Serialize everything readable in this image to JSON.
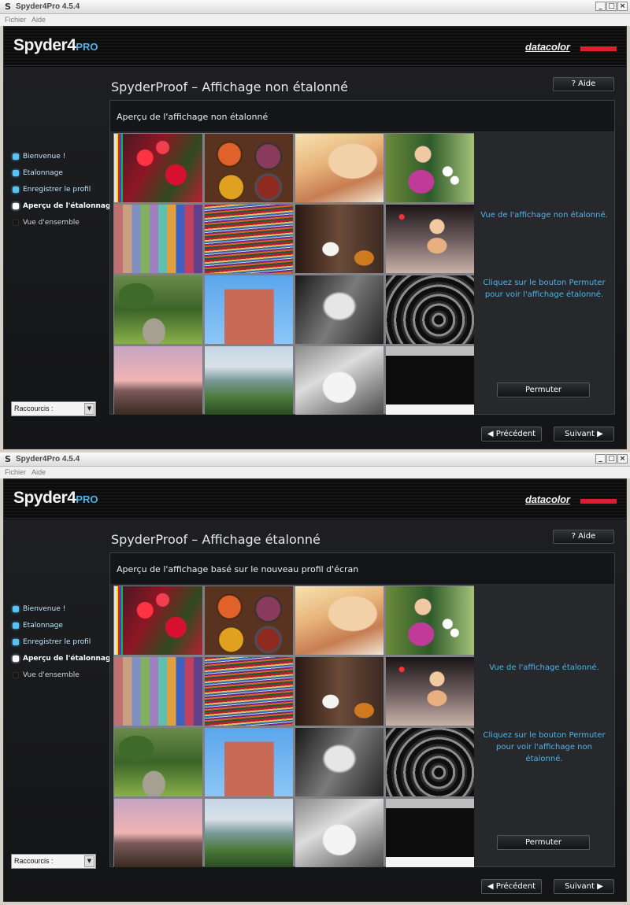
{
  "windows": [
    {
      "title": "Spyder4Pro 4.5.4",
      "menu": [
        "Fichier",
        "Aide"
      ],
      "logo": {
        "main": "Spyder4",
        "suffix": "PRO"
      },
      "brand": "datacolor",
      "heading": "SpyderProof – Affichage non étalonné",
      "help_label": "? Aide",
      "panel_title": "Aperçu de l'affichage non étalonné",
      "steps": [
        {
          "label": "Bienvenue !",
          "state": "done"
        },
        {
          "label": "Etalonnage",
          "state": "done"
        },
        {
          "label": "Enregistrer le profil",
          "state": "done"
        },
        {
          "label": "Aperçu de l'étalonnage",
          "state": "active"
        },
        {
          "label": "Vue d'ensemble",
          "state": "inactive"
        }
      ],
      "shortcut_label": "Raccourcis :",
      "message_view": "Vue de l'affichage non étalonné.",
      "message_hint": "Cliquez sur le bouton Permuter pour voir l'affichage étalonné.",
      "permuter_label": "Permuter",
      "prev_label": "◀ Précédent",
      "next_label": "Suivant ▶"
    },
    {
      "title": "Spyder4Pro 4.5.4",
      "menu": [
        "Fichier",
        "Aide"
      ],
      "logo": {
        "main": "Spyder4",
        "suffix": "PRO"
      },
      "brand": "datacolor",
      "heading": "SpyderProof – Affichage étalonné",
      "help_label": "? Aide",
      "panel_title": "Aperçu de l'affichage basé sur le nouveau profil d'écran",
      "steps": [
        {
          "label": "Bienvenue !",
          "state": "done"
        },
        {
          "label": "Etalonnage",
          "state": "done"
        },
        {
          "label": "Enregistrer le profil",
          "state": "done"
        },
        {
          "label": "Aperçu de l'étalonnage",
          "state": "active"
        },
        {
          "label": "Vue d'ensemble",
          "state": "inactive"
        }
      ],
      "shortcut_label": "Raccourcis :",
      "message_view": "Vue de l'affichage étalonné.",
      "message_hint": "Cliquez sur le bouton Permuter pour voir l'affichage non étalonné.",
      "permuter_label": "Permuter",
      "prev_label": "◀ Précédent",
      "next_label": "Suivant ▶"
    }
  ],
  "window_controls": {
    "minimize": "_",
    "maximize": "□",
    "close": "×"
  },
  "photos": [
    "red-flowers",
    "spice-bowls",
    "portrait-blonde",
    "girl-with-flowers",
    "color-checker",
    "woven-textile",
    "guitar-player",
    "vintage-portrait",
    "garden-urn",
    "adobe-church",
    "bw-portrait",
    "spiral-staircase",
    "sunset-hills",
    "tuscan-landscape",
    "bw-scooter",
    "bw-test-chart"
  ],
  "colors": {
    "accent": "#4fb4ea",
    "brand_red": "#e01d2d",
    "background": "#0a0a0b",
    "panel": "#27282c"
  }
}
